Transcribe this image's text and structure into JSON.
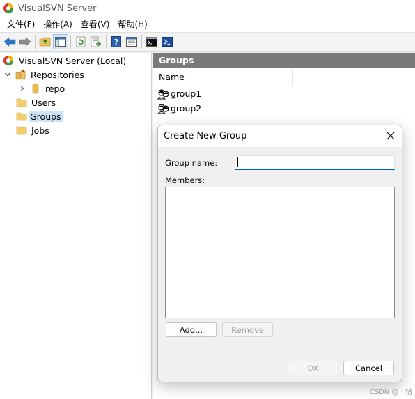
{
  "window": {
    "title": "VisualSVN Server"
  },
  "menu": {
    "items": [
      "文件(F)",
      "操作(A)",
      "查看(V)",
      "帮助(H)"
    ]
  },
  "tree": {
    "root": "VisualSVN Server (Local)",
    "repositories": "Repositories",
    "repo": "repo",
    "users": "Users",
    "groups": "Groups",
    "jobs": "Jobs"
  },
  "panel": {
    "header": "Groups",
    "column_name": "Name",
    "rows": [
      "group1",
      "group2"
    ]
  },
  "dialog": {
    "title": "Create New Group",
    "group_name_label": "Group name:",
    "group_name_value": "",
    "members_label": "Members:",
    "add_button": "Add...",
    "remove_button": "Remove",
    "ok_button": "OK",
    "cancel_button": "Cancel"
  },
  "watermark": "CSDN @ · 惜",
  "colors": {
    "selection": "#cce4f7",
    "header_bar": "#7a7a7a",
    "focus_underline": "#0067c0"
  }
}
